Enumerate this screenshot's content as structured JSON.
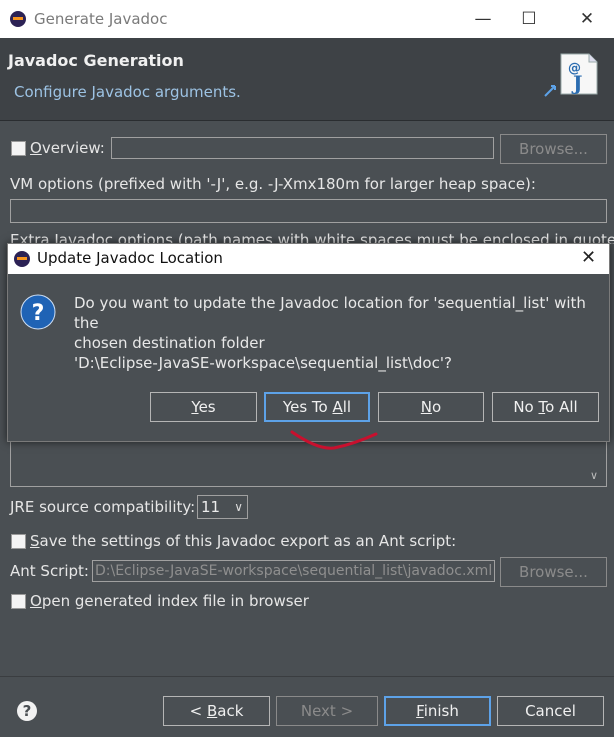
{
  "window": {
    "title": "Generate Javadoc",
    "minimize": "—",
    "maximize": "☐",
    "close": "✕"
  },
  "header": {
    "title": "Javadoc Generation",
    "subtitle": "Configure Javadoc arguments."
  },
  "overview": {
    "label_pre": "",
    "label_u": "O",
    "label_post": "verview:",
    "checked": false,
    "value": "",
    "browse": "Browse..."
  },
  "vm_options": {
    "label": "VM options (prefixed with '-J', e.g. -J-Xmx180m for larger heap space):",
    "value": ""
  },
  "extra_options": {
    "label": "Extra Javadoc options (path names with white spaces must be enclosed in quotes):"
  },
  "jre": {
    "label": "JRE source compatibility:",
    "value": "11"
  },
  "save_ant": {
    "label_pre": "",
    "label_u": "S",
    "label_post": "ave the settings of this Javadoc export as an Ant script:",
    "checked": false
  },
  "ant_script": {
    "label": "Ant Script:",
    "value": "D:\\Eclipse-JavaSE-workspace\\sequential_list\\javadoc.xml",
    "browse": "Browse..."
  },
  "open_index": {
    "label_pre": "",
    "label_u": "O",
    "label_post": "pen generated index file in browser",
    "checked": false
  },
  "footer": {
    "back": {
      "pre": "< ",
      "u": "B",
      "post": "ack"
    },
    "next": "Next >",
    "finish": {
      "pre": "",
      "u": "F",
      "post": "inish"
    },
    "cancel": "Cancel"
  },
  "dialog": {
    "title": "Update Javadoc Location",
    "close": "✕",
    "message_line1": "Do you want to update the Javadoc location for 'sequential_list' with the",
    "message_line2": "chosen destination folder",
    "message_line3": "'D:\\Eclipse-JavaSE-workspace\\sequential_list\\doc'?",
    "buttons": {
      "yes": {
        "pre": "",
        "u": "Y",
        "post": "es"
      },
      "yes_to_all": {
        "pre": "Yes To ",
        "u": "A",
        "post": "ll"
      },
      "no": {
        "pre": "",
        "u": "N",
        "post": "o"
      },
      "no_to_all": {
        "pre": "No ",
        "u": "T",
        "post": "o All"
      }
    }
  },
  "colors": {
    "background": "#4a4f53",
    "accent": "#5da2e8",
    "subtitle": "#9dc3e4",
    "annotation": "#c8102e"
  }
}
